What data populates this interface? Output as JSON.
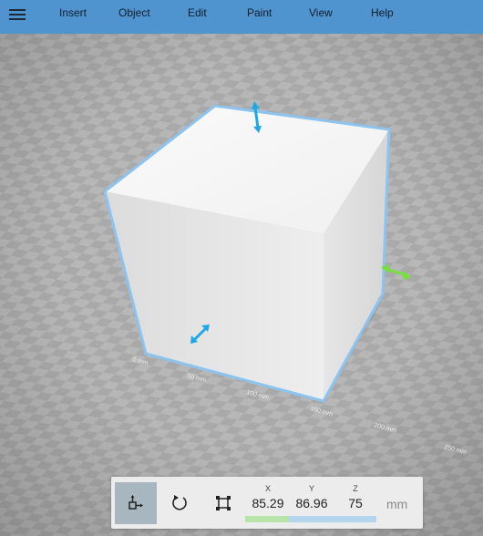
{
  "menu": {
    "items": [
      {
        "id": "insert",
        "label": "Insert"
      },
      {
        "id": "object",
        "label": "Object"
      },
      {
        "id": "edit",
        "label": "Edit"
      },
      {
        "id": "paint",
        "label": "Paint"
      },
      {
        "id": "view",
        "label": "View"
      },
      {
        "id": "help",
        "label": "Help"
      }
    ]
  },
  "ruler": {
    "labels": [
      "0 mm",
      "50 mm",
      "100 mm",
      "150 mm",
      "200 mm",
      "250 mm"
    ]
  },
  "toolbar": {
    "tools": [
      {
        "id": "move",
        "icon": "move-icon",
        "active": true
      },
      {
        "id": "rotate",
        "icon": "rotate-icon",
        "active": false
      },
      {
        "id": "scale",
        "icon": "scale-icon",
        "active": false
      }
    ],
    "coords": {
      "x": {
        "label": "X",
        "value": "85.29"
      },
      "y": {
        "label": "Y",
        "value": "86.96"
      },
      "z": {
        "label": "Z",
        "value": "75"
      }
    },
    "unit": "mm"
  },
  "colors": {
    "menubar": "#4f93cf",
    "selection": "#8cc3ef",
    "handle_vertical": "#1fa8e8",
    "handle_x": "#76e03a",
    "toolbar_active": "#a8b6bf"
  }
}
